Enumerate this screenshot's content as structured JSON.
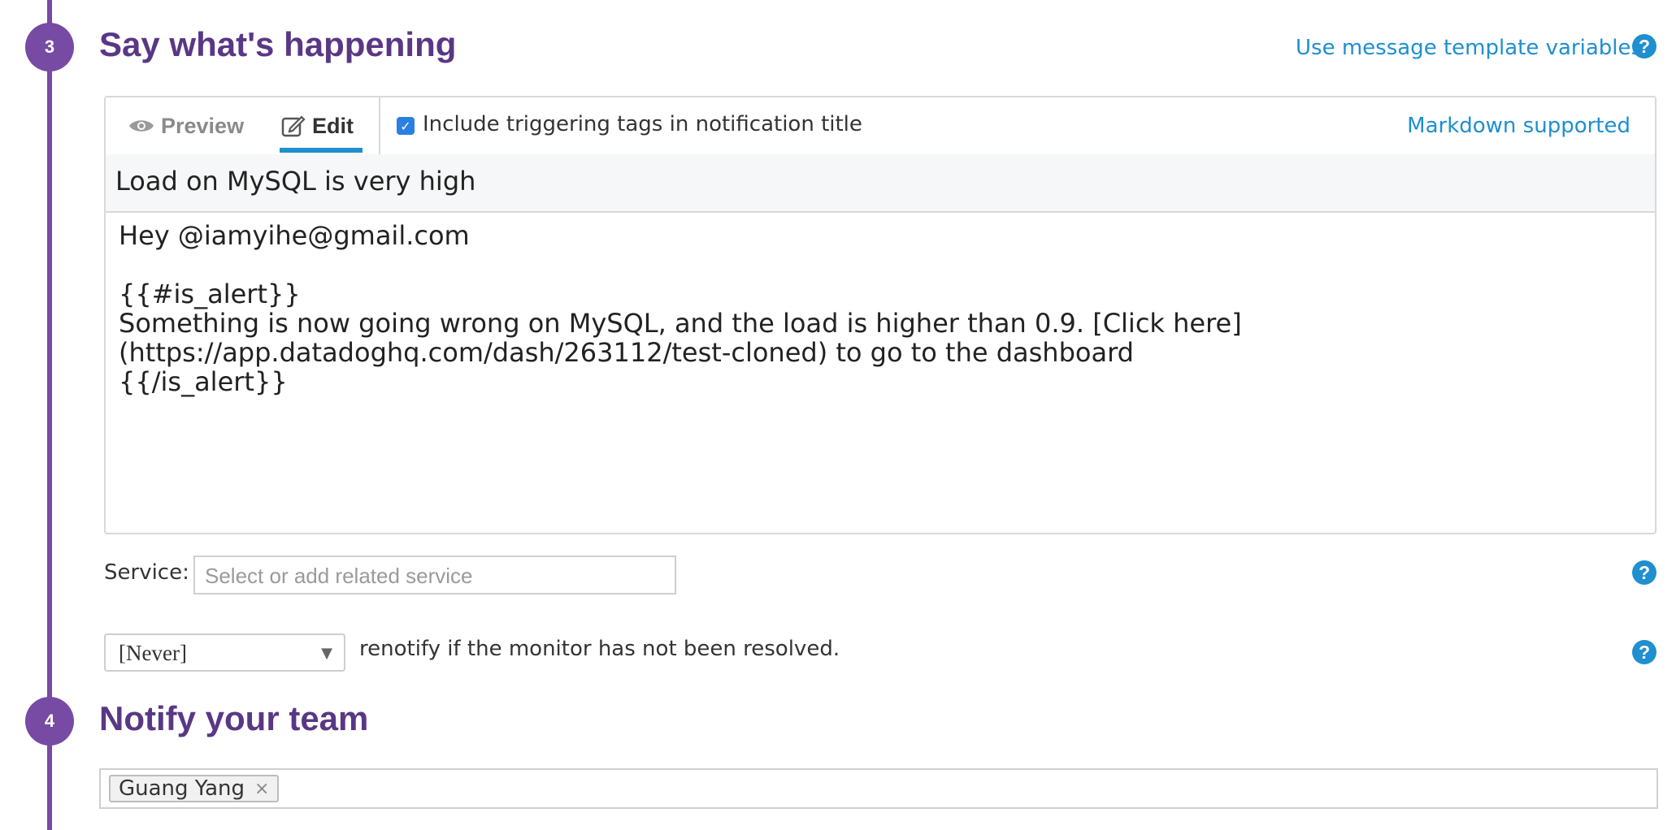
{
  "steps": [
    {
      "number": "3",
      "title": "Say what's happening"
    },
    {
      "number": "4",
      "title": "Notify your team"
    }
  ],
  "header": {
    "template_link": "Use message template variables",
    "help_icon": "question-circle-icon"
  },
  "editor": {
    "tabs": {
      "preview": {
        "label": "Preview",
        "icon": "eye-icon",
        "active": false
      },
      "edit": {
        "label": "Edit",
        "icon": "edit-icon",
        "active": true
      }
    },
    "include_tags": {
      "checked": true,
      "label": "Include triggering tags in notification title"
    },
    "markdown_link": "Markdown supported",
    "title_value": "Load on MySQL is very high",
    "body_value": "Hey @iamyihe@gmail.com\n\n{{#is_alert}}\nSomething is now going wrong on MySQL, and the load is higher than 0.9. [Click here]\n(https://app.datadoghq.com/dash/263112/test-cloned) to go to the dashboard\n{{/is_alert}}"
  },
  "service": {
    "label": "Service:",
    "placeholder": "Select or add related service"
  },
  "renotify": {
    "selected": "[Never]",
    "text": "renotify if the monitor has not been resolved."
  },
  "team": {
    "tags": [
      {
        "label": "Guang Yang",
        "remove": "×"
      }
    ]
  },
  "colors": {
    "accent_purple": "#774aa4",
    "title_purple": "#5a3785",
    "link_blue": "#1f8fcf",
    "checkbox_blue": "#2b7fe0"
  }
}
